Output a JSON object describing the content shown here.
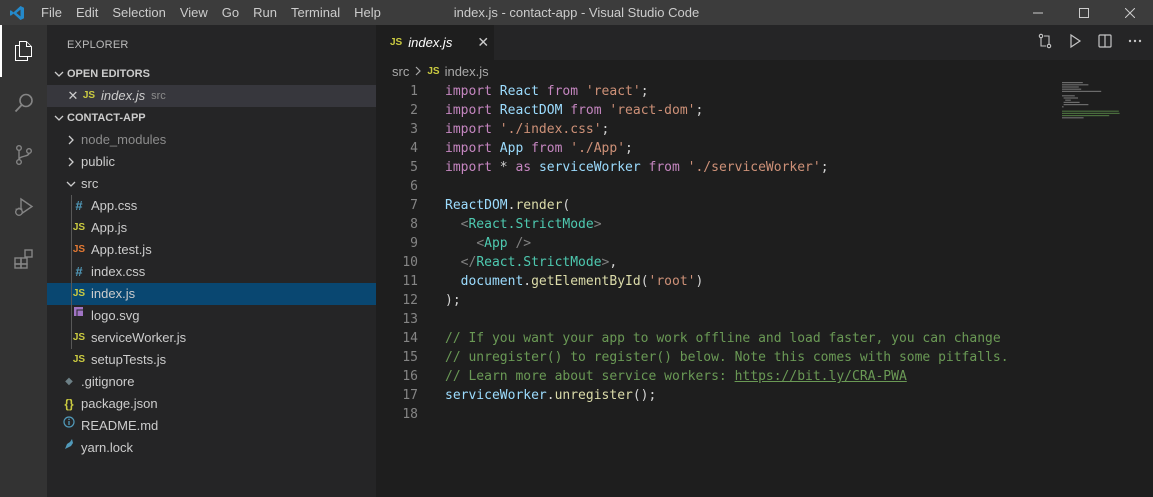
{
  "window": {
    "title": "index.js - contact-app - Visual Studio Code",
    "menu": [
      "File",
      "Edit",
      "Selection",
      "View",
      "Go",
      "Run",
      "Terminal",
      "Help"
    ]
  },
  "explorer": {
    "title": "EXPLORER",
    "open_editors": {
      "label": "OPEN EDITORS",
      "items": [
        {
          "name": "index.js",
          "path": "src"
        }
      ]
    },
    "project": {
      "label": "CONTACT-APP",
      "tree": [
        {
          "name": "node_modules",
          "type": "folder",
          "dim": true
        },
        {
          "name": "public",
          "type": "folder"
        },
        {
          "name": "src",
          "type": "folder-open"
        },
        {
          "name": "App.css",
          "type": "css"
        },
        {
          "name": "App.js",
          "type": "js"
        },
        {
          "name": "App.test.js",
          "type": "testjs"
        },
        {
          "name": "index.css",
          "type": "css"
        },
        {
          "name": "index.js",
          "type": "js",
          "selected": true
        },
        {
          "name": "logo.svg",
          "type": "svg"
        },
        {
          "name": "serviceWorker.js",
          "type": "js"
        },
        {
          "name": "setupTests.js",
          "type": "js"
        },
        {
          "name": ".gitignore",
          "type": "git"
        },
        {
          "name": "package.json",
          "type": "json"
        },
        {
          "name": "README.md",
          "type": "info"
        },
        {
          "name": "yarn.lock",
          "type": "yarn"
        }
      ]
    }
  },
  "editor": {
    "tab": {
      "icon": "JS",
      "name": "index.js"
    },
    "breadcrumb": {
      "folder": "src",
      "file": "index.js"
    },
    "lines": [
      "import React from 'react';",
      "import ReactDOM from 'react-dom';",
      "import './index.css';",
      "import App from './App';",
      "import * as serviceWorker from './serviceWorker';",
      "",
      "ReactDOM.render(",
      "  <React.StrictMode>",
      "    <App />",
      "  </React.StrictMode>,",
      "  document.getElementById('root')",
      ");",
      "",
      "// If you want your app to work offline and load faster, you can change",
      "// unregister() to register() below. Note this comes with some pitfalls.",
      "// Learn more about service workers: https://bit.ly/CRA-PWA",
      "serviceWorker.unregister();",
      ""
    ]
  },
  "colors": {
    "accent": "#094771",
    "js": "#cbcb41",
    "css": "#519aba",
    "keyword": "#c586c0",
    "string": "#ce9178",
    "comment": "#6a9955"
  }
}
